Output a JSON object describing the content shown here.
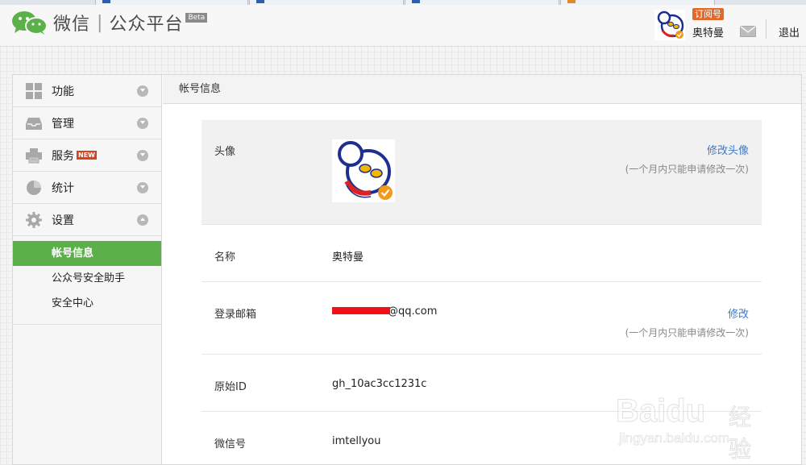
{
  "header": {
    "logo_title": "微信",
    "logo_separator": "|",
    "logo_subtitle": "公众平台",
    "beta_label": "Beta",
    "account_type_badge": "订阅号",
    "user_name": "奥特曼",
    "logout_label": "退出"
  },
  "sidebar": {
    "items": [
      {
        "label": "功能",
        "icon": "grid-icon"
      },
      {
        "label": "管理",
        "icon": "inbox-icon"
      },
      {
        "label": "服务",
        "icon": "printer-icon",
        "badge": "NEW"
      },
      {
        "label": "统计",
        "icon": "pie-chart-icon"
      },
      {
        "label": "设置",
        "icon": "gear-icon"
      }
    ],
    "settings_subitems": [
      {
        "label": "帐号信息",
        "active": true
      },
      {
        "label": "公众号安全助手",
        "active": false
      },
      {
        "label": "安全中心",
        "active": false
      }
    ]
  },
  "content": {
    "title": "帐号信息",
    "avatar_row": {
      "label": "头像",
      "action": "修改头像",
      "note": "(一个月内只能申请修改一次)"
    },
    "name_row": {
      "label": "名称",
      "value": "奥特曼"
    },
    "email_row": {
      "label": "登录邮箱",
      "value_suffix": "@qq.com",
      "action": "修改",
      "note": "(一个月内只能申请修改一次)"
    },
    "id_row": {
      "label": "原始ID",
      "value": "gh_10ac3cc1231c"
    },
    "wechat_row": {
      "label": "微信号",
      "value": "imtellyou"
    }
  },
  "watermark": {
    "brand": "Baidu",
    "brand_cn": "经验",
    "url": "jingyan.baidu.com"
  },
  "colors": {
    "accent_green": "#5bb04a",
    "link_blue": "#3d7bc6",
    "badge_orange": "#e06a2b",
    "redaction_red": "#f01018"
  }
}
